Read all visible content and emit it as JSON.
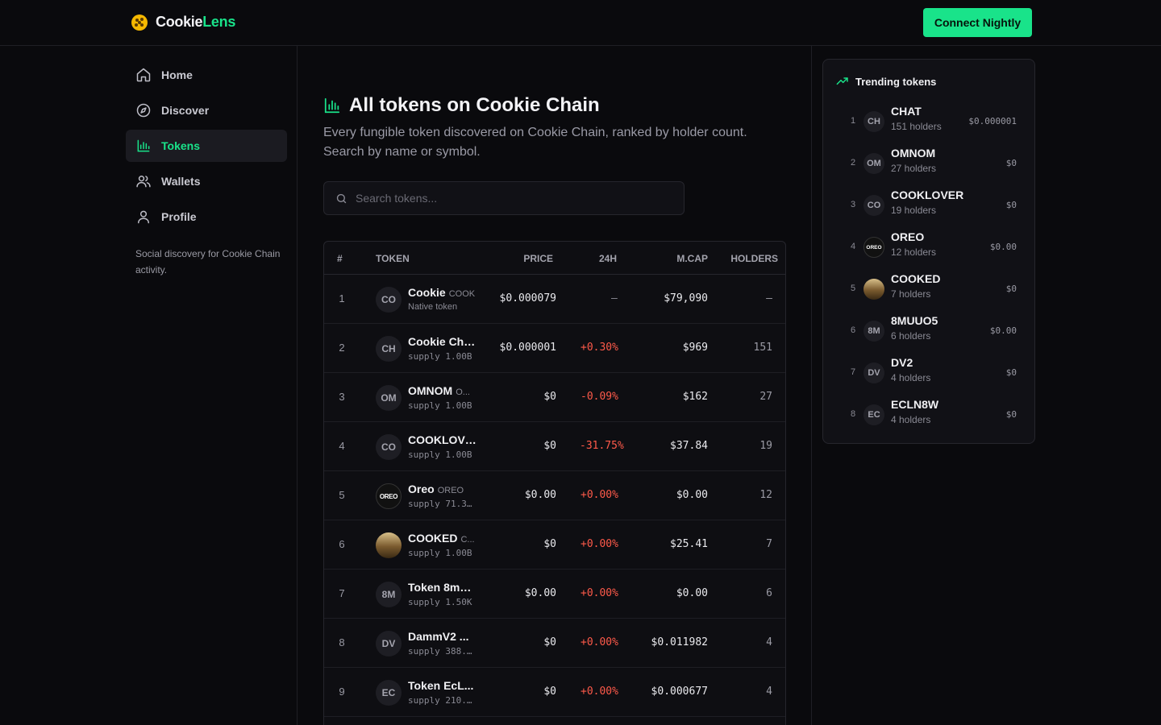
{
  "brand": {
    "name_a": "Cookie",
    "name_b": "Lens"
  },
  "header": {
    "connect_label": "Connect Nightly"
  },
  "sidebar": {
    "items": [
      {
        "label": "Home",
        "icon": "home-icon"
      },
      {
        "label": "Discover",
        "icon": "compass-icon"
      },
      {
        "label": "Tokens",
        "icon": "bar-chart-icon",
        "active": true
      },
      {
        "label": "Wallets",
        "icon": "users-icon"
      },
      {
        "label": "Profile",
        "icon": "user-icon"
      }
    ],
    "note": "Social discovery for Cookie Chain activity."
  },
  "main": {
    "title": "All tokens on Cookie Chain",
    "description": "Every fungible token discovered on Cookie Chain, ranked by holder count. Search by name or symbol.",
    "search_placeholder": "Search tokens...",
    "columns": {
      "rank": "#",
      "token": "Token",
      "price": "Price",
      "change": "24h",
      "mcap": "M.Cap",
      "holders": "Holders"
    },
    "rows": [
      {
        "rank": "1",
        "avatar": "CO",
        "name": "Cookie",
        "symbol": "COOK",
        "sub": "Native token",
        "price": "$0.000079",
        "change": "–",
        "mcap": "$79,090",
        "holders": "–"
      },
      {
        "rank": "2",
        "avatar": "CH",
        "name": "Cookie Cha...",
        "symbol": "",
        "sub": "supply 1.00B",
        "price": "$0.000001",
        "change": "+0.30%",
        "mcap": "$969",
        "holders": "151"
      },
      {
        "rank": "3",
        "avatar": "OM",
        "name": "OMNOM",
        "symbol": "O...",
        "sub": "supply 1.00B",
        "price": "$0",
        "change": "-0.09%",
        "mcap": "$162",
        "holders": "27"
      },
      {
        "rank": "4",
        "avatar": "CO",
        "name": "COOKLOVE...",
        "symbol": "",
        "sub": "supply 1.00B",
        "price": "$0",
        "change": "-31.75%",
        "mcap": "$37.84",
        "holders": "19"
      },
      {
        "rank": "5",
        "avatar": "OREO",
        "name": "Oreo",
        "symbol": "OREO",
        "sub": "supply 71.3...",
        "price": "$0.00",
        "change": "+0.00%",
        "mcap": "$0.00",
        "holders": "12"
      },
      {
        "rank": "6",
        "avatar": "",
        "name": "COOKED",
        "symbol": "C...",
        "sub": "supply 1.00B",
        "price": "$0",
        "change": "+0.00%",
        "mcap": "$25.41",
        "holders": "7"
      },
      {
        "rank": "7",
        "avatar": "8M",
        "name": "Token 8mU...",
        "symbol": "",
        "sub": "supply 1.50K",
        "price": "$0.00",
        "change": "+0.00%",
        "mcap": "$0.00",
        "holders": "6"
      },
      {
        "rank": "8",
        "avatar": "DV",
        "name": "DammV2 ...",
        "symbol": "",
        "sub": "supply 388...",
        "price": "$0",
        "change": "+0.00%",
        "mcap": "$0.011982",
        "holders": "4"
      },
      {
        "rank": "9",
        "avatar": "EC",
        "name": "Token EcL...",
        "symbol": "",
        "sub": "supply 210...",
        "price": "$0",
        "change": "+0.00%",
        "mcap": "$0.000677",
        "holders": "4"
      }
    ]
  },
  "trending": {
    "title": "Trending tokens",
    "items": [
      {
        "rank": "1",
        "avatar": "CH",
        "symbol": "CHAT",
        "holders": "151 holders",
        "price": "$0.000001"
      },
      {
        "rank": "2",
        "avatar": "OM",
        "symbol": "OMNOM",
        "holders": "27 holders",
        "price": "$0"
      },
      {
        "rank": "3",
        "avatar": "CO",
        "symbol": "COOKLOVER",
        "holders": "19 holders",
        "price": "$0"
      },
      {
        "rank": "4",
        "avatar": "OREO",
        "symbol": "OREO",
        "holders": "12 holders",
        "price": "$0.00"
      },
      {
        "rank": "5",
        "avatar": "",
        "symbol": "COOKED",
        "holders": "7 holders",
        "price": "$0"
      },
      {
        "rank": "6",
        "avatar": "8M",
        "symbol": "8MUUO5",
        "holders": "6 holders",
        "price": "$0.00"
      },
      {
        "rank": "7",
        "avatar": "DV",
        "symbol": "DV2",
        "holders": "4 holders",
        "price": "$0"
      },
      {
        "rank": "8",
        "avatar": "EC",
        "symbol": "ECLN8W",
        "holders": "4 holders",
        "price": "$0"
      }
    ]
  },
  "colors": {
    "accent": "#19e38a",
    "change_red": "#ff5a4a",
    "background": "#0a0a0d"
  }
}
